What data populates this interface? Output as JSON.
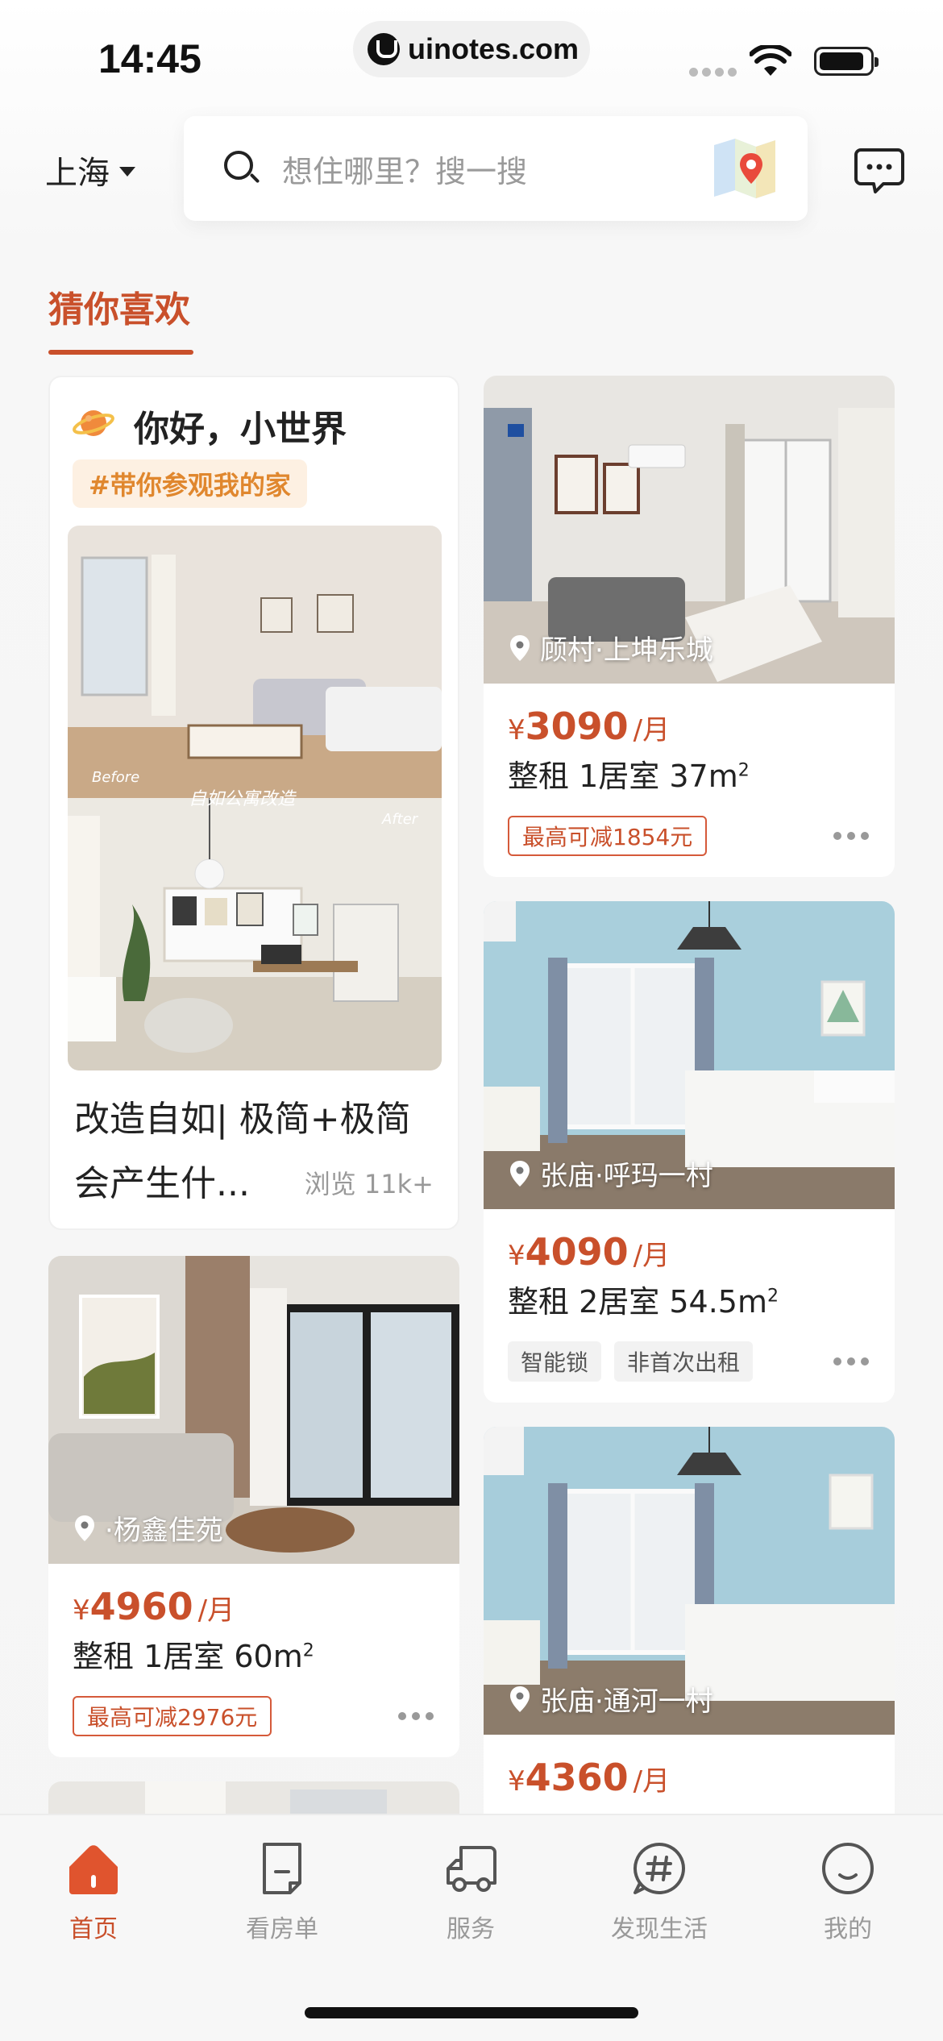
{
  "status_bar": {
    "time": "14:45",
    "url": "uinotes.com"
  },
  "header": {
    "city": "上海",
    "search_placeholder": "想住哪里？搜一搜",
    "icons": [
      "search-icon",
      "map-icon",
      "message-icon"
    ]
  },
  "section_tab": "猜你喜欢",
  "featured": {
    "title": "你好，小世界",
    "tag": "#带你参观我的家",
    "img_caption_before": "Before",
    "img_caption_center": "自如公寓改造",
    "img_caption_after": "After",
    "text_line1": "改造自如| 极简+极简",
    "text_line2": "会产生什...",
    "views": "浏览 11k+"
  },
  "listings": [
    {
      "location": "顾村·上坤乐城",
      "price_symbol": "¥",
      "price": "3090",
      "unit": "/月",
      "spec": "整租 1居室 37m",
      "discount": "最高可减1854元"
    },
    {
      "location": "张庙·呼玛一村",
      "price_symbol": "¥",
      "price": "4090",
      "unit": "/月",
      "spec": "整租 2居室 54.5m",
      "tags": [
        "智能锁",
        "非首次出租"
      ]
    },
    {
      "location": "·杨鑫佳苑",
      "price_symbol": "¥",
      "price": "4960",
      "unit": "/月",
      "spec": "整租 1居室 60m",
      "discount": "最高可减2976元"
    },
    {
      "location": "张庙·通河一村",
      "price_symbol": "¥",
      "price": "4360",
      "unit": "/月"
    }
  ],
  "spec_superscript": "2",
  "bottom_nav": [
    {
      "label": "首页",
      "icon": "home-icon",
      "active": true
    },
    {
      "label": "看房单",
      "icon": "list-icon",
      "active": false
    },
    {
      "label": "服务",
      "icon": "truck-icon",
      "active": false
    },
    {
      "label": "发现生活",
      "icon": "hashtag-icon",
      "active": false
    },
    {
      "label": "我的",
      "icon": "smile-icon",
      "active": false
    }
  ],
  "colors": {
    "accent": "#c9502b",
    "tag_orange": "#e0872e",
    "room_blue": "#a9cfdc"
  }
}
